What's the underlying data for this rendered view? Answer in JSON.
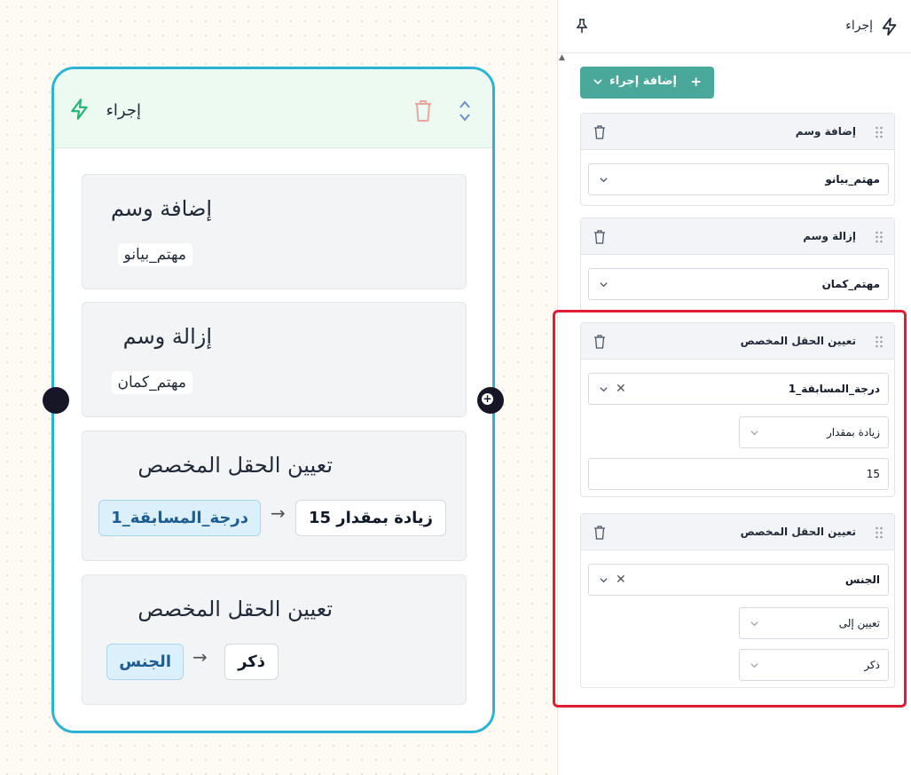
{
  "node": {
    "title": "إجراء",
    "sections": [
      {
        "title": "إضافة وسم",
        "tag": "مهتم_بيانو"
      },
      {
        "title": "إزالة وسم",
        "tag": "مهتم_كمان"
      },
      {
        "title": "تعيين الحقل المخصص",
        "field": "درجة_المسابقة_1",
        "value": "زيادة بمقدار 15"
      },
      {
        "title": "تعيين الحقل المخصص",
        "field": "الجنس",
        "value": "ذكر"
      }
    ],
    "arrow": "→",
    "port_symbol": "+"
  },
  "panel": {
    "title": "إجراء",
    "add_action_label": "إضافة إجراء",
    "add_symbol": "+",
    "cards": [
      {
        "title": "إضافة وسم",
        "value": "مهتم_بيانو"
      },
      {
        "title": "إزالة وسم",
        "value": "مهتم_كمان"
      },
      {
        "title": "تعيين الحقل المخصص",
        "field": "درجة_المسابقة_1",
        "operation": "زيادة بمقدار",
        "amount": "15"
      },
      {
        "title": "تعيين الحقل المخصص",
        "field": "الجنس",
        "operation": "تعيين إلى",
        "amount": "ذكر"
      }
    ],
    "clear_symbol": "✕",
    "scroll_up_symbol": "▲"
  },
  "colors": {
    "node_border": "#2bb3d6",
    "node_header": "#ecfaf2",
    "accent_button": "#4aa89a",
    "highlight": "#e11d35",
    "field_chip": "#dcf0fb"
  }
}
